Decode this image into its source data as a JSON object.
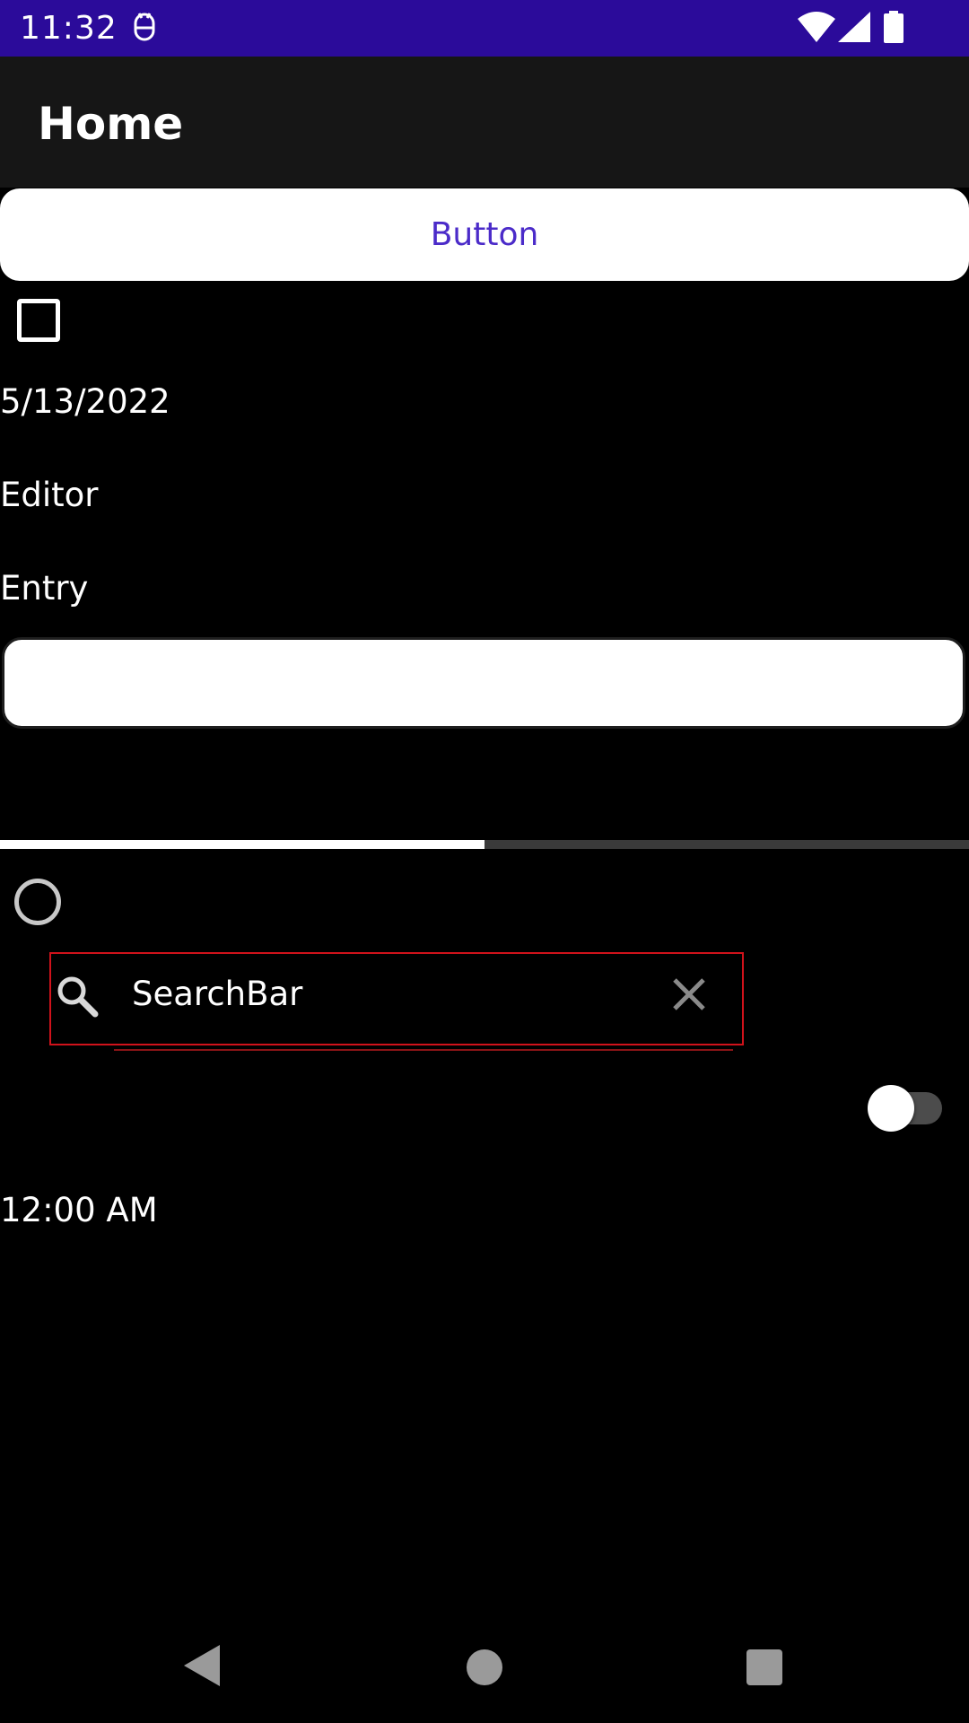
{
  "status_bar": {
    "time": "11:32",
    "background_color": "#2b0b9a",
    "icons": [
      "app-notification-icon",
      "wifi-icon",
      "signal-icon",
      "battery-icon"
    ]
  },
  "toolbar": {
    "title": "Home",
    "background_color": "#161616"
  },
  "button": {
    "label": "Button",
    "text_color": "#4b2bc9"
  },
  "checkbox": {
    "checked": false
  },
  "date_picker": {
    "value": "5/13/2022"
  },
  "editor": {
    "text": "Editor"
  },
  "entry": {
    "label": "Entry",
    "value": ""
  },
  "progress": {
    "fraction": 0.5
  },
  "radio": {
    "selected": false
  },
  "search_bar": {
    "text": "SearchBar",
    "highlight_color": "#d0121b",
    "icons": [
      "search-icon",
      "clear-icon"
    ]
  },
  "switch": {
    "on": false
  },
  "time_picker": {
    "value": "12:00 AM"
  },
  "nav_bar": {
    "icons": [
      "back-icon",
      "home-icon",
      "recents-icon"
    ]
  }
}
